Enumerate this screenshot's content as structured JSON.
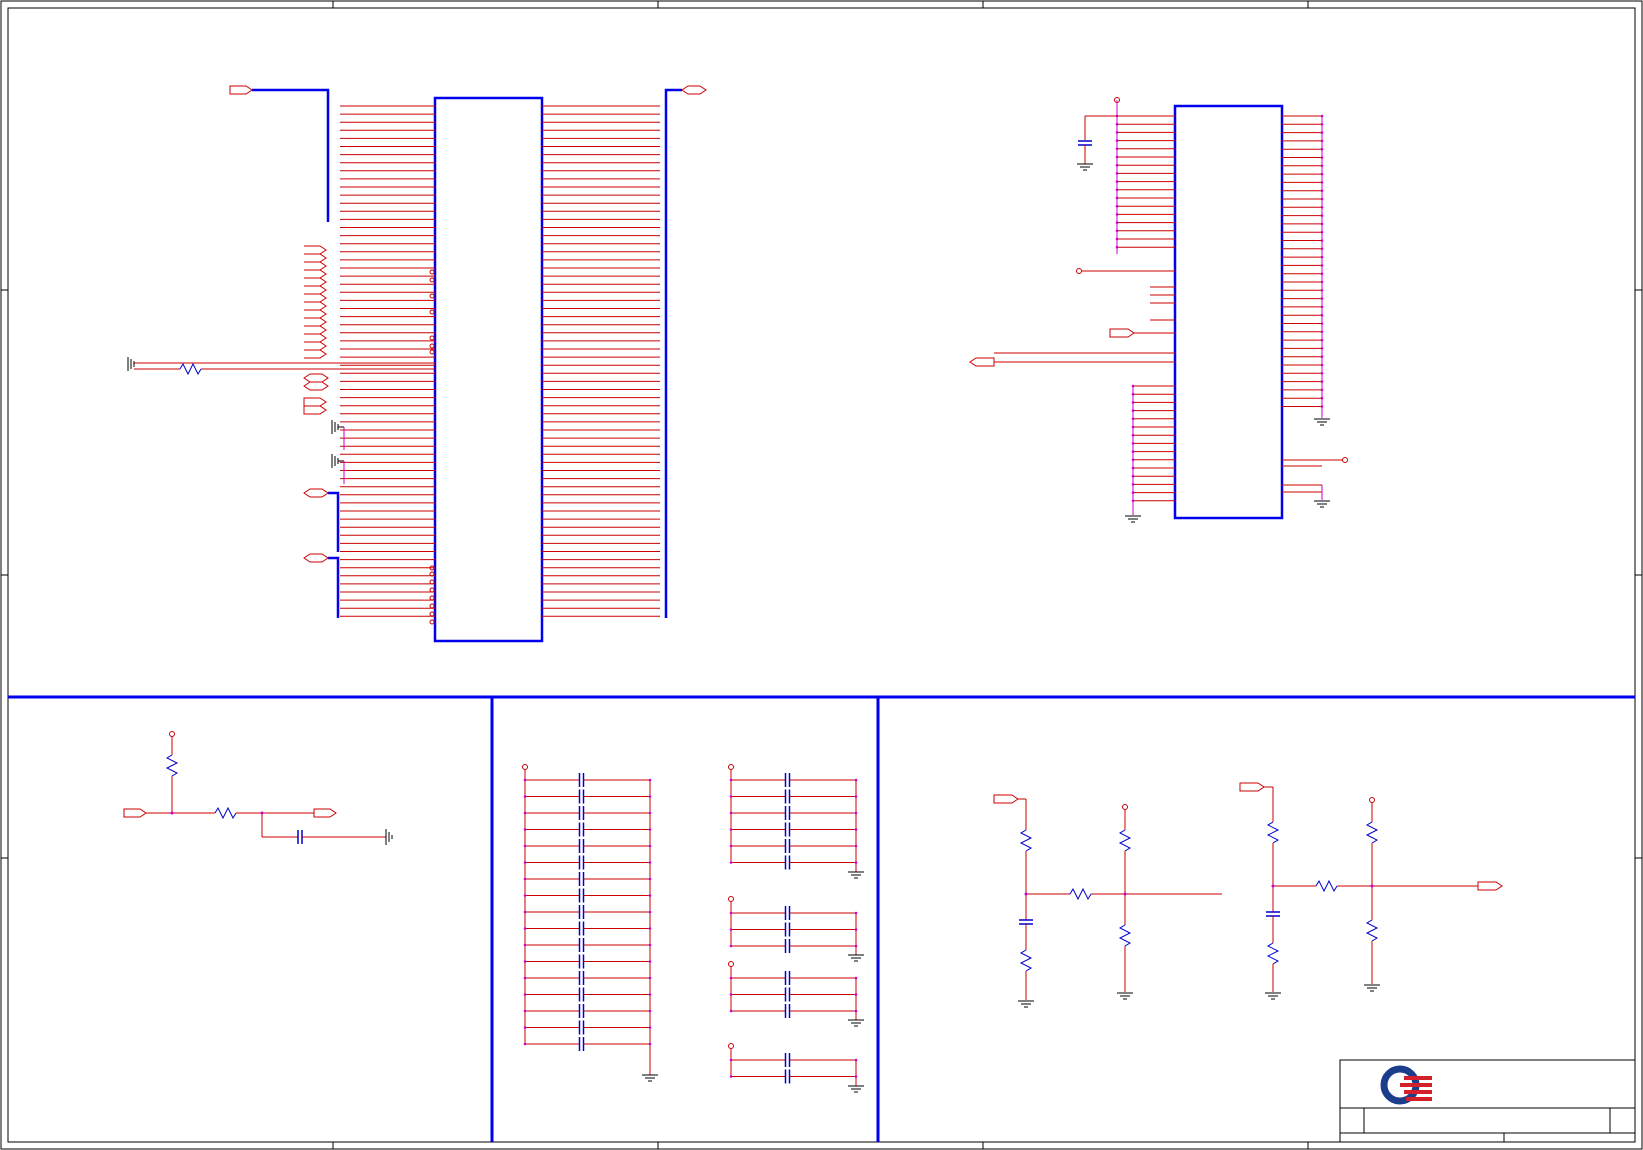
{
  "sheet": {
    "border_color": "#000000",
    "wire_color": "#cc0000",
    "bus_color": "#0000ee",
    "junction_color": "#cc00cc",
    "component_color": "#0000cc"
  },
  "title_block": {
    "logo": "quanta-logo-icon",
    "logo_colors": [
      "#1a3e8c",
      "#d4202a"
    ],
    "title": "",
    "size": "",
    "document_number": "",
    "rev": "",
    "date": "",
    "sheet_of": ""
  },
  "sections": [
    {
      "name": "main-connector-section"
    },
    {
      "name": "right-ic-section"
    },
    {
      "name": "rc-filter-section"
    },
    {
      "name": "decoupling-capacitor-section"
    },
    {
      "name": "resistor-divider-section"
    }
  ]
}
